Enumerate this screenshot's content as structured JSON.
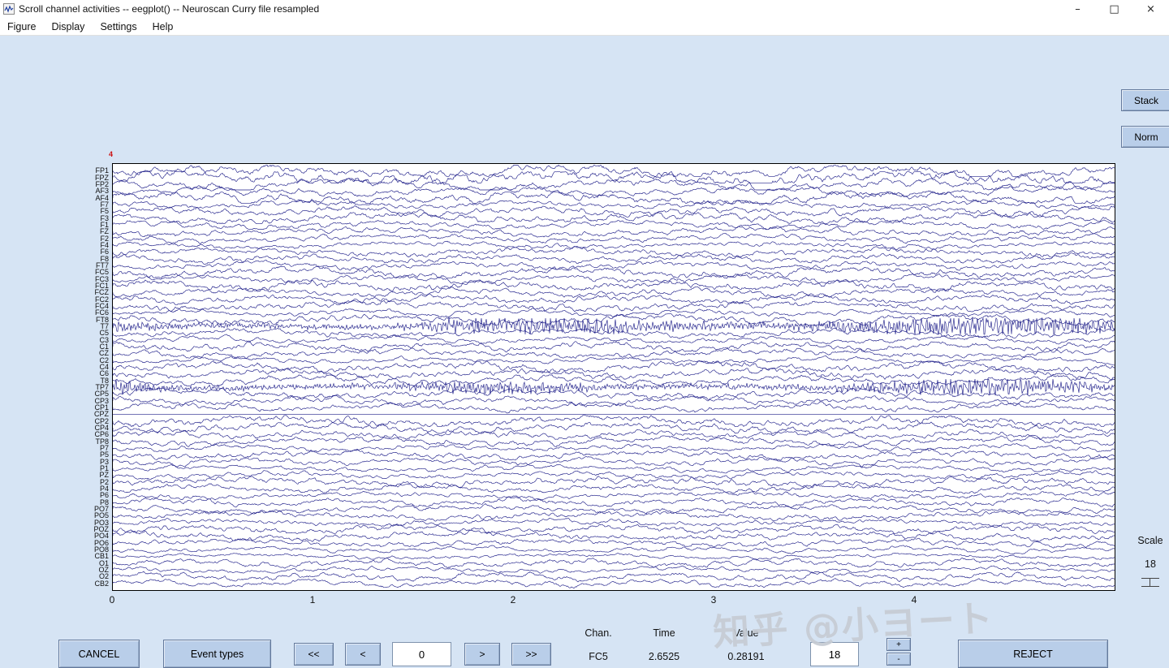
{
  "window": {
    "title": "Scroll channel activities -- eegplot() -- Neuroscan Curry file resampled",
    "minimize_icon": "–",
    "maximize_icon": "□",
    "close_icon": "×"
  },
  "menu": {
    "items": [
      "Figure",
      "Display",
      "Settings",
      "Help"
    ]
  },
  "right_panel": {
    "stack": "Stack",
    "norm": "Norm",
    "scale_label": "Scale",
    "scale_value": "18"
  },
  "plot": {
    "channels": [
      "FP1",
      "FPZ",
      "FP2",
      "AF3",
      "AF4",
      "F7",
      "F5",
      "F3",
      "F1",
      "FZ",
      "F2",
      "F4",
      "F6",
      "F8",
      "FT7",
      "FC5",
      "FC3",
      "FC1",
      "FCZ",
      "FC2",
      "FC4",
      "FC6",
      "FT8",
      "T7",
      "C5",
      "C3",
      "C1",
      "CZ",
      "C2",
      "C4",
      "C6",
      "T8",
      "TP7",
      "CP5",
      "CP3",
      "CP1",
      "CPZ",
      "CP2",
      "CP4",
      "CP6",
      "TP8",
      "P7",
      "P5",
      "P3",
      "P1",
      "PZ",
      "P2",
      "P4",
      "P6",
      "P8",
      "PO7",
      "PO5",
      "PO3",
      "POZ",
      "PO4",
      "PO6",
      "PO8",
      "CB1",
      "O1",
      "OZ",
      "O2",
      "CB2"
    ],
    "x_ticks": [
      "0",
      "1",
      "2",
      "3",
      "4"
    ],
    "event_marker": "4",
    "flat_channel": "CPZ",
    "artifact_channels": [
      "T7",
      "TP7"
    ]
  },
  "bottom": {
    "cancel": "CANCEL",
    "event_types": "Event types",
    "fast_back": "<<",
    "back": "<",
    "position_value": "0",
    "forward": ">",
    "fast_forward": ">>",
    "chan_label": "Chan.",
    "time_label": "Time",
    "value_label": "Value",
    "chan_value": "FC5",
    "time_value": "2.6525",
    "value_value": "0.28191",
    "scale_value": "18",
    "spike_up": "+",
    "spike_down": "-",
    "reject": "REJECT"
  },
  "watermark": "知乎 @小ヨート",
  "colors": {
    "trace": "#20208a",
    "background": "#d6e4f4",
    "button": "#b9cee9"
  }
}
